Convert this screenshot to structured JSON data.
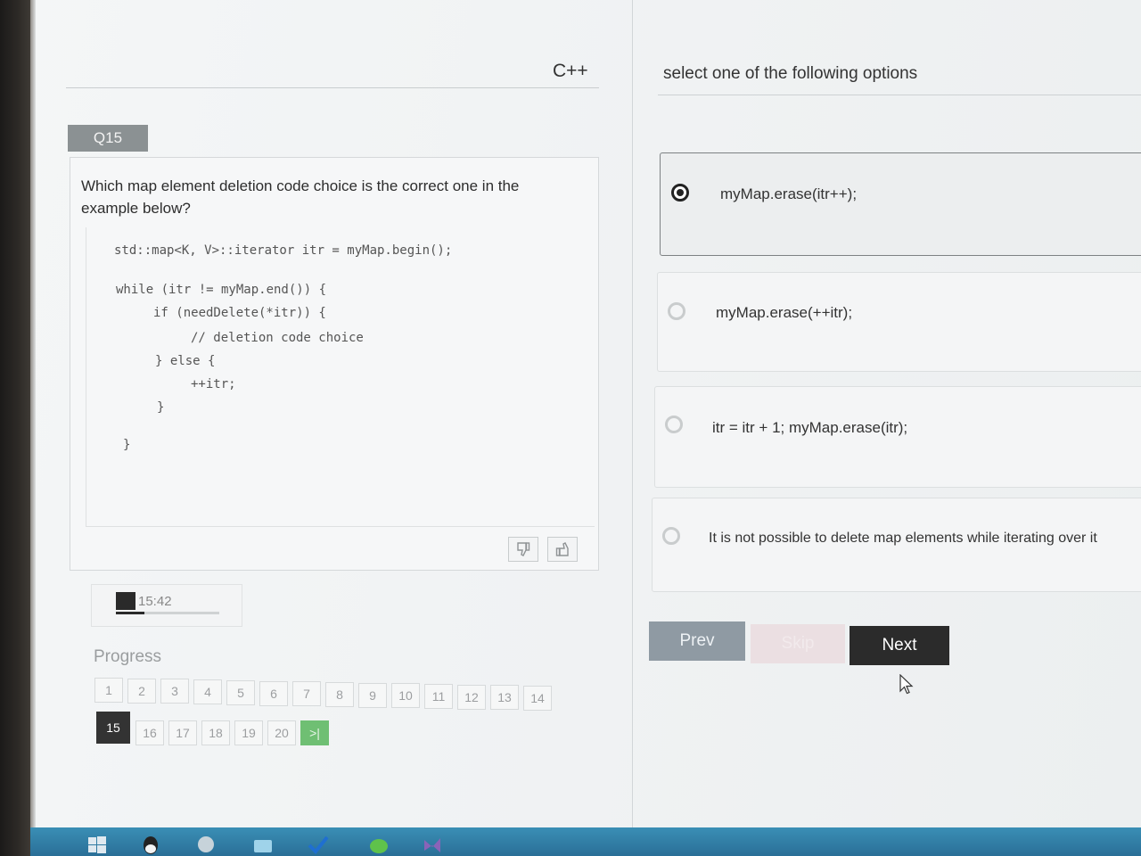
{
  "quiz": {
    "language": "C++",
    "question_number": "Q15",
    "question_text": "Which map element deletion code choice is the correct one in the example below?",
    "code_lines": [
      "std::map<K, V>::iterator itr = myMap.begin();",
      "while (itr != myMap.end()) {",
      "if (needDelete(*itr)) {",
      "// deletion code choice",
      "} else {",
      "++itr;",
      "}",
      "}"
    ],
    "timer": "15:42",
    "timer_progress": 0.28,
    "progress_label": "Progress",
    "pages": [
      "1",
      "2",
      "3",
      "4",
      "5",
      "6",
      "7",
      "8",
      "9",
      "10",
      "11",
      "12",
      "13",
      "14",
      "15",
      "16",
      "17",
      "18",
      "19",
      "20",
      ">|"
    ],
    "current_page": "15"
  },
  "answers": {
    "instruction": "select one of the following options",
    "options": [
      {
        "label": "myMap.erase(itr++);",
        "selected": true
      },
      {
        "label": "myMap.erase(++itr);",
        "selected": false
      },
      {
        "label": "itr = itr + 1; myMap.erase(itr);",
        "selected": false
      },
      {
        "label": "It is not possible to delete map elements while iterating over it",
        "selected": false
      }
    ]
  },
  "nav": {
    "prev_label": "Prev",
    "skip_label": "Skip",
    "next_label": "Next"
  },
  "icons": {
    "thumbs_down": "thumbs-down-icon",
    "thumbs_up": "thumbs-up-icon",
    "cursor": "mouse-cursor-icon"
  },
  "colors": {
    "next_button": "#2b2b2b",
    "prev_button": "#8f9aa3",
    "last_page_button": "#6fbf73",
    "question_tab": "#8b9193"
  }
}
